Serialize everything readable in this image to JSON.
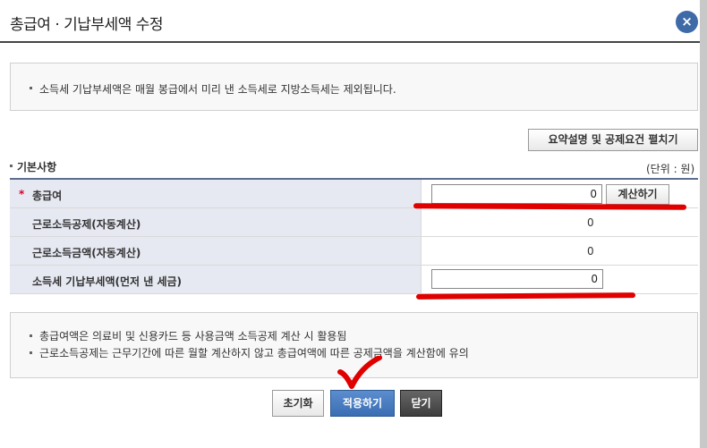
{
  "dialog": {
    "title": "총급여 · 기납부세액 수정",
    "close_symbol": "×"
  },
  "info": {
    "text": "소득세 기납부세액은 매월 봉급에서 미리 낸 소득세로 지방소득세는 제외됩니다."
  },
  "toolbar": {
    "expand_label": "요약설명 및 공제요건 펼치기"
  },
  "section": {
    "title": "기본사항",
    "unit": "(단위 : 원)"
  },
  "form": {
    "rows": [
      {
        "label": "총급여",
        "required": "*",
        "value": "0",
        "button": "계산하기"
      },
      {
        "label": "근로소득공제(자동계산)",
        "value": "0"
      },
      {
        "label": "근로소득금액(자동계산)",
        "value": "0"
      },
      {
        "label": "소득세 기납부세액(먼저 낸 세금)",
        "value": "0"
      }
    ]
  },
  "notes": [
    "총급여액은 의료비 및 신용카드 등 사용금액 소득공제 계산 시 활용됨",
    "근로소득공제는 근무기간에 따른 월할 계산하지 않고 총급여액에 따른 공제금액을 계산함에 유의"
  ],
  "buttons": {
    "reset": "초기화",
    "apply": "적용하기",
    "close": "닫기"
  },
  "colors": {
    "accent": "#3e6aa8",
    "annotation": "#e00000",
    "required": "#d9002b"
  }
}
